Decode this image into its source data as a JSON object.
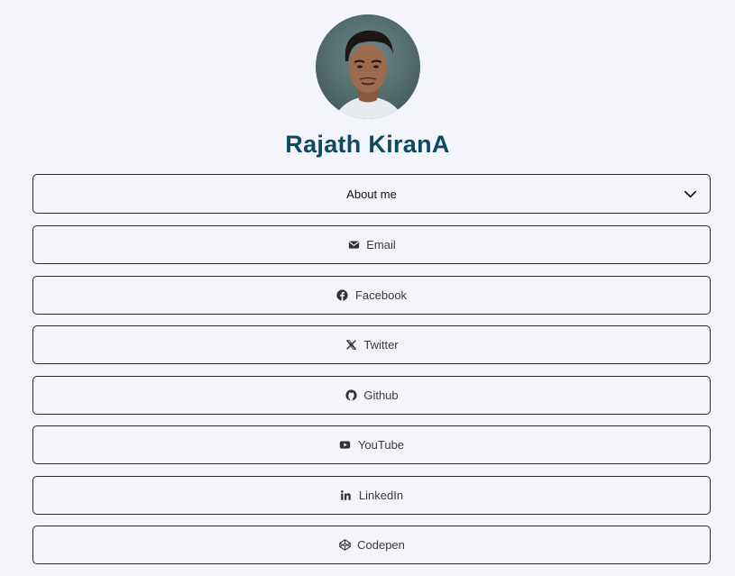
{
  "profile": {
    "name": "Rajath KiranA",
    "avatar_icon": "profile-photo"
  },
  "links": {
    "about": {
      "label": "About me",
      "icon": "chevron-down-icon"
    },
    "email": {
      "label": "Email",
      "icon": "envelope-icon"
    },
    "facebook": {
      "label": "Facebook",
      "icon": "facebook-icon"
    },
    "twitter": {
      "label": "Twitter",
      "icon": "x-logo-icon"
    },
    "github": {
      "label": "Github",
      "icon": "github-icon"
    },
    "youtube": {
      "label": "YouTube",
      "icon": "youtube-icon"
    },
    "linkedin": {
      "label": "LinkedIn",
      "icon": "linkedin-icon"
    },
    "codepen": {
      "label": "Codepen",
      "icon": "codepen-icon"
    }
  },
  "colors": {
    "background": "#f4f4fb",
    "name": "#0f4a63",
    "border": "#2a2a2a"
  }
}
